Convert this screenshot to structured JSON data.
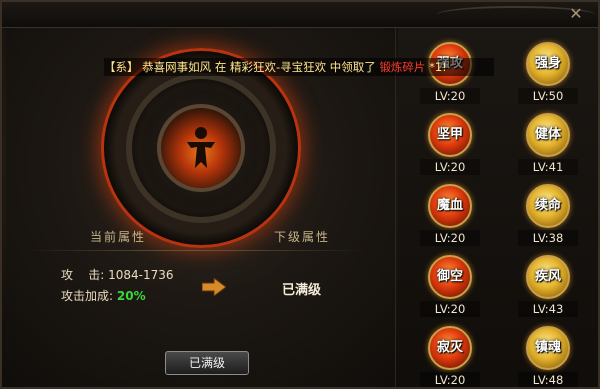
{
  "system_message": {
    "prefix": "【系】",
    "player": "恭喜网事如风",
    "text": "在 精彩狂欢-寻宝狂欢 中领取了",
    "item": "锻炼碎片",
    "suffix": "*1!"
  },
  "attributes": {
    "current_header": "当前属性",
    "next_header": "下级属性",
    "attack_label": "攻    击:",
    "attack_value": "1084-1736",
    "attack_bonus_label": "攻击加成:",
    "attack_bonus_value": "20%",
    "next_level_text": "已满级"
  },
  "max_button_label": "已满级",
  "skills": [
    {
      "name": "强攻",
      "level": "LV:20",
      "style": "red"
    },
    {
      "name": "强身",
      "level": "LV:50",
      "style": "gold"
    },
    {
      "name": "坚甲",
      "level": "LV:20",
      "style": "red"
    },
    {
      "name": "健体",
      "level": "LV:41",
      "style": "gold"
    },
    {
      "name": "魔血",
      "level": "LV:20",
      "style": "red"
    },
    {
      "name": "续命",
      "level": "LV:38",
      "style": "gold"
    },
    {
      "name": "御空",
      "level": "LV:20",
      "style": "red"
    },
    {
      "name": "疾风",
      "level": "LV:43",
      "style": "gold"
    },
    {
      "name": "寂灭",
      "level": "LV:20",
      "style": "red"
    },
    {
      "name": "镇魂",
      "level": "LV:48",
      "style": "gold"
    }
  ],
  "colors": {
    "accent_red": "#b8330f",
    "message_yellow": "#ffe48a",
    "highlight_red": "#ff3a2a",
    "bonus_green": "#38d838"
  }
}
